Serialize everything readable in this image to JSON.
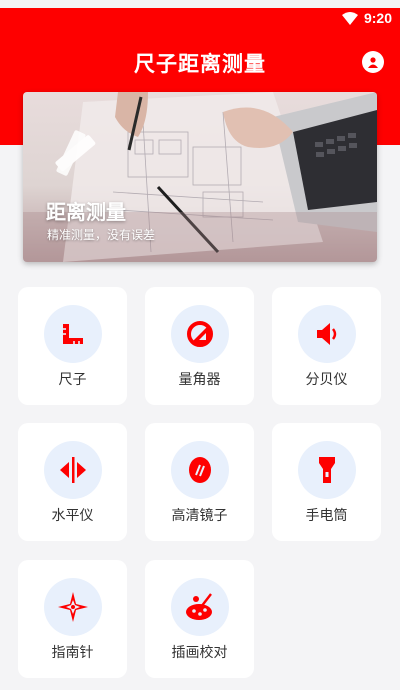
{
  "status_bar": {
    "time": "9:20"
  },
  "header": {
    "title": "尺子距离测量"
  },
  "banner": {
    "title": "距离测量",
    "subtitle": "精准测量，没有误差"
  },
  "tools": [
    {
      "label": "尺子",
      "icon": "ruler-icon"
    },
    {
      "label": "量角器",
      "icon": "protractor-icon"
    },
    {
      "label": "分贝仪",
      "icon": "speaker-icon"
    },
    {
      "label": "水平仪",
      "icon": "level-icon"
    },
    {
      "label": "高清镜子",
      "icon": "mirror-icon"
    },
    {
      "label": "手电筒",
      "icon": "flashlight-icon"
    },
    {
      "label": "指南针",
      "icon": "compass-icon"
    },
    {
      "label": "插画校对",
      "icon": "palette-icon"
    }
  ],
  "colors": {
    "accent": "#fe0000",
    "icon_bg": "#e8f0fc",
    "page_bg": "#f4f4f6"
  }
}
